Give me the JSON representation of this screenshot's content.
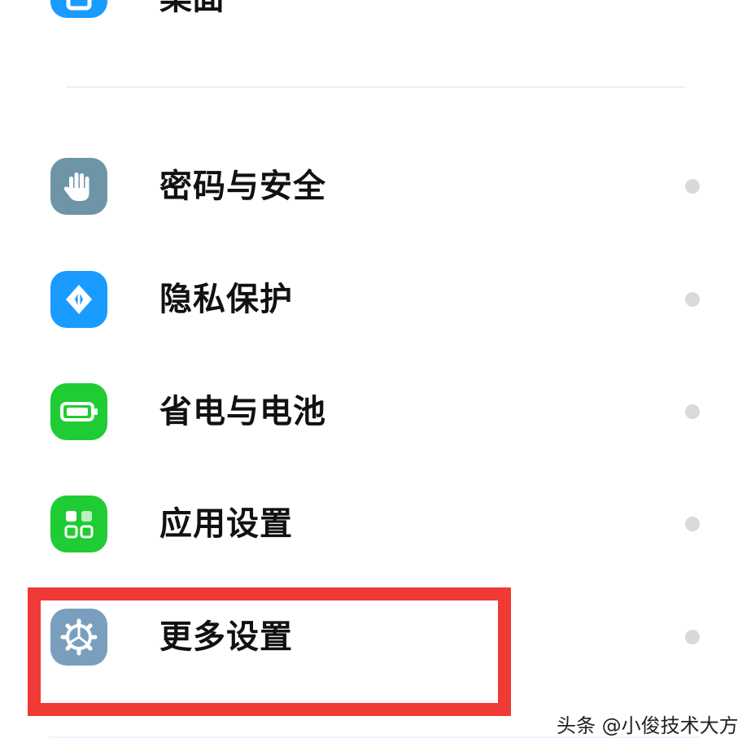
{
  "top_item": {
    "label": "桌面",
    "icon": "desktop-icon",
    "color": "#1a9bff"
  },
  "items": [
    {
      "label": "密码与安全",
      "icon": "hand-icon",
      "color": "#6e95a7"
    },
    {
      "label": "隐私保护",
      "icon": "privacy-shield-icon",
      "color": "#1a9bff"
    },
    {
      "label": "省电与电池",
      "icon": "battery-icon",
      "color": "#1fcc33"
    },
    {
      "label": "应用设置",
      "icon": "apps-grid-icon",
      "color": "#1fcc33"
    },
    {
      "label": "更多设置",
      "icon": "gear-icon",
      "color": "#7a9fbe"
    }
  ],
  "highlight_color": "#f03a35",
  "watermark": {
    "text": "头条 @小俊技术大方"
  }
}
